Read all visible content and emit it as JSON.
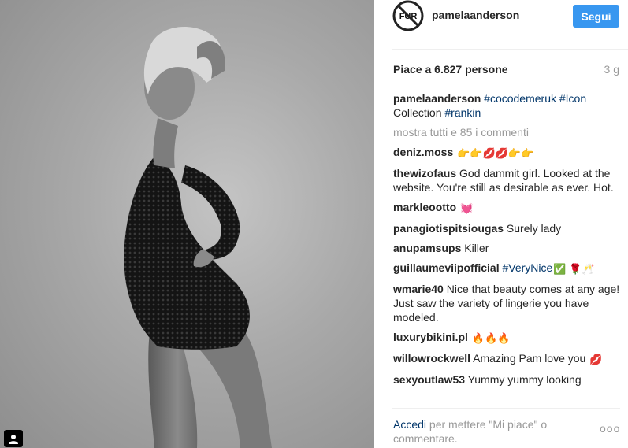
{
  "post": {
    "username": "pamelaanderson",
    "follow_label": "Segui",
    "likes_text": "Piace a 6.827 persone",
    "age": "3 g",
    "avatar_text": "FUR",
    "caption": {
      "user": "pamelaanderson",
      "tag1": "#cocodemeruk",
      "tag2": "#Icon",
      "text1": "Collection",
      "tag3": "#rankin"
    },
    "show_all_comments": "mostra tutti e 85 i commenti",
    "login_link": "Accedi",
    "login_text": " per mettere \"Mi piace\" o commentare.",
    "options_label": "ooo"
  },
  "comments": [
    {
      "user": "deniz.moss",
      "text": "",
      "emoji": "👉👉💋💋👉👉"
    },
    {
      "user": "thewizofaus",
      "text": "God dammit girl. Looked at the website. You're still as desirable as ever. Hot.",
      "emoji": ""
    },
    {
      "user": "markleootto",
      "text": "",
      "emoji": "💓"
    },
    {
      "user": "panagiotispitsiougas",
      "text": "Surely lady",
      "emoji": ""
    },
    {
      "user": "anupamsups",
      "text": "Killer",
      "emoji": ""
    },
    {
      "user": "guillaumeviipofficial",
      "text": "",
      "tag": "#VeryNice",
      "emoji": "✅ 🌹🥂"
    },
    {
      "user": "wmarie40",
      "text": "Nice that beauty comes at any age! Just saw the variety of lingerie you have modeled.",
      "emoji": ""
    },
    {
      "user": "luxurybikini.pl",
      "text": "",
      "emoji": "🔥🔥🔥"
    },
    {
      "user": "willowrockwell",
      "text": "Amazing Pam love you",
      "emoji": "💋"
    },
    {
      "user": "sexyoutlaw53",
      "text": "Yummy yummy looking",
      "emoji": ""
    }
  ]
}
